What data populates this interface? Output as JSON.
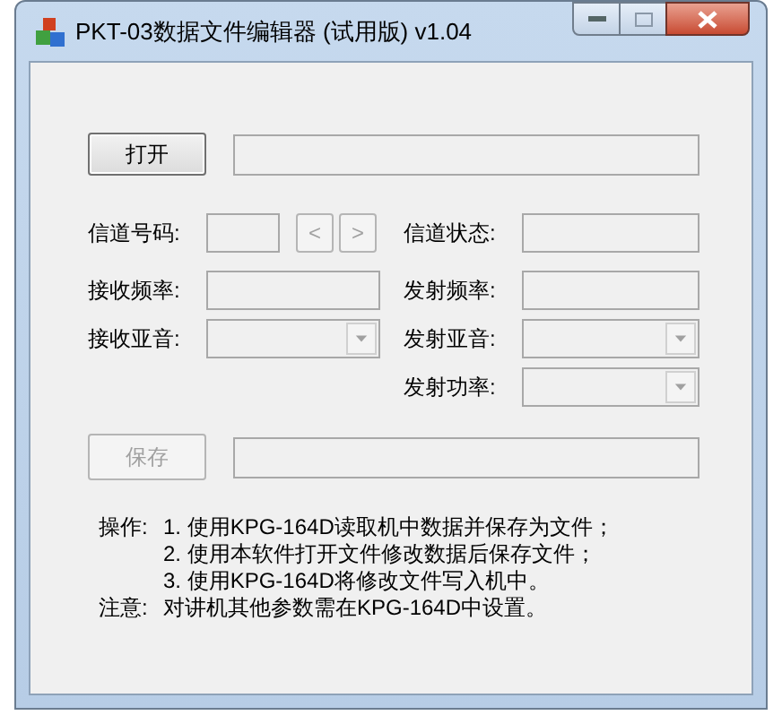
{
  "window": {
    "title": "PKT-03数据文件编辑器 (试用版) v1.04"
  },
  "open_button": {
    "label": "打开",
    "disabled": false
  },
  "left_fields": [
    {
      "label": "信道号码:",
      "kind": "channel",
      "nav": [
        {
          "label": "<",
          "disabled": true
        },
        {
          "label": ">",
          "disabled": true
        }
      ]
    },
    {
      "label": "接收频率:",
      "kind": "text"
    },
    {
      "label": "接收亚音:",
      "kind": "dropdown"
    }
  ],
  "right_fields": [
    {
      "label": "信道状态:",
      "kind": "text"
    },
    {
      "label": "发射频率:",
      "kind": "text"
    },
    {
      "label": "发射亚音:",
      "kind": "dropdown"
    },
    {
      "label": "发射功率:",
      "kind": "dropdown"
    }
  ],
  "save_button": {
    "label": "保存",
    "disabled": true
  },
  "instructions": [
    {
      "label": "操作:",
      "text": "1. 使用KPG-164D读取机中数据并保存为文件；"
    },
    {
      "text": "2. 使用本软件打开文件修改数据后保存文件；"
    },
    {
      "text": "3. 使用KPG-164D将修改文件写入机中。"
    },
    {
      "label": "注意:",
      "text": "对讲机其他参数需在KPG-164D中设置。"
    }
  ]
}
